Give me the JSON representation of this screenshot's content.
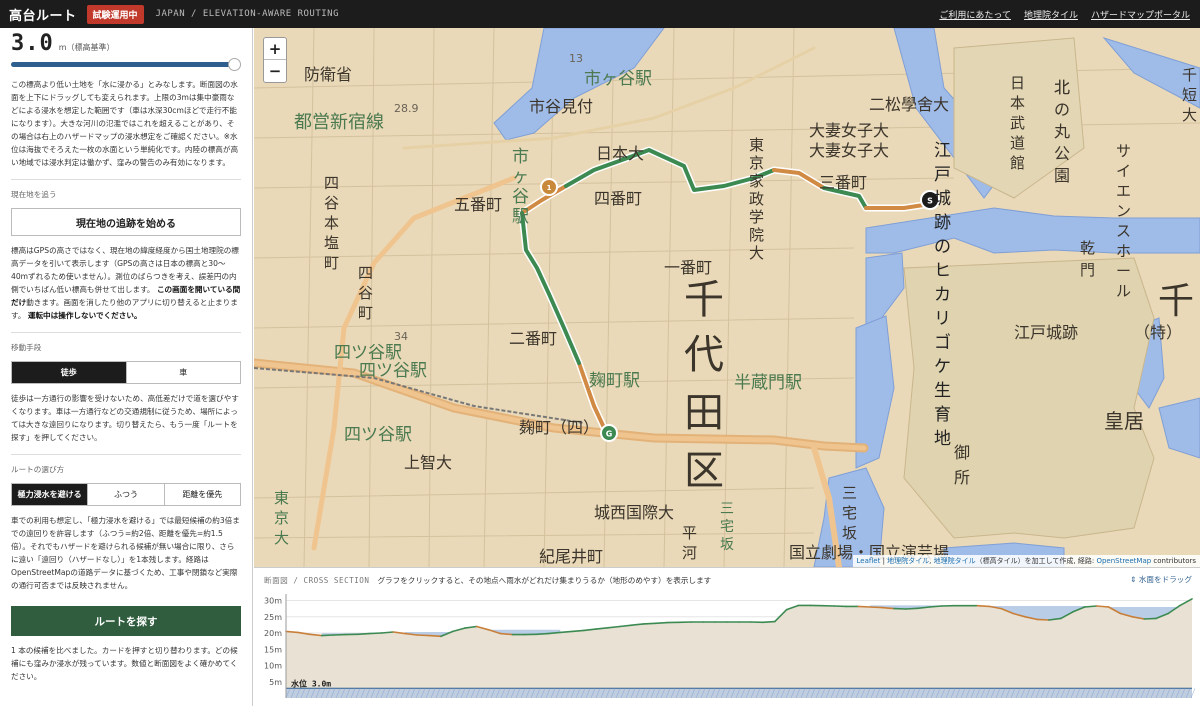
{
  "header": {
    "app_title": "高台ルート",
    "badge": "試験運用中",
    "subtitle": "JAPAN / ELEVATION-AWARE ROUTING",
    "nav": [
      "ご利用にあたって",
      "地理院タイル",
      "ハザードマップポータル"
    ]
  },
  "water_level": {
    "value": "3.0",
    "unit": "m（標高基準）",
    "fraction": 0.97,
    "description": "この標高より低い土地を「水に浸かる」とみなします。断面図の水面を上下にドラッグしても変えられます。上限の3mは集中豪雨などによる浸水を想定した範囲です（車は水深30cmほどで走行不能になります）。大きな河川の氾濫ではこれを超えることがあり、その場合は右上のハザードマップの浸水想定をご確認ください。※水位は海抜でそろえた一枚の水面という単純化です。内陸の標高が高い地域では浸水判定は働かず、窪みの警告のみ有効になります。"
  },
  "tracking": {
    "label": "現在地を追う",
    "button": "現在地の追跡を始める",
    "text_plain": "標高はGPSの高さではなく、現在地の緯度経度から国土地理院の標高データを引いて表示します（GPSの高さは日本の標高と30〜40mずれるため使いません）。測位のばらつきを考え、誤差円の内側でいちばん低い標高も併せて出します。",
    "text_bold_1": "この画面を開いている間だけ",
    "text_mid": "動きます。画面を消したり他のアプリに切り替えると止まります。",
    "text_bold_2": "運転中は操作しないでください。"
  },
  "transport": {
    "label": "移動手段",
    "options": [
      "徒歩",
      "車"
    ],
    "selected": "徒歩",
    "description": "徒歩は一方通行の影響を受けないため、高低差だけで道を選びやすくなります。車は一方通行などの交通規制に従うため、場所によっては大きな遠回りになります。切り替えたら、もう一度「ルートを探す」を押してください。"
  },
  "route_mode": {
    "label": "ルートの選び方",
    "options": [
      "極力浸水を避ける",
      "ふつう",
      "距離を優先"
    ],
    "selected": "極力浸水を避ける",
    "description": "車での利用も想定し、「極力浸水を避ける」では最短候補の約3倍までの遠回りを許容します（ふつう=約2倍、距離を優先=約1.5倍）。それでもハザードを避けられる候補が無い場合に限り、さらに遠い「遠回り（ハザードなし）」を1本残します。経路はOpenStreetMapの道路データに基づくため、工事や閉鎖など実際の通行可否までは反映されません。"
  },
  "search": {
    "button": "ルートを探す",
    "result": "1 本の候補を比べました。カードを押すと切り替わります。どの候補にも窪みか浸水が残っています。数値と断面図をよく確かめてください。"
  },
  "map": {
    "zoom_in": "+",
    "zoom_out": "−",
    "labels": {
      "district": [
        "千",
        "代",
        "田",
        "区"
      ],
      "ichigaya": "市ヶ谷駅",
      "ichigaya_v": [
        "市",
        "ヶ",
        "谷",
        "駅"
      ],
      "yotsuya": "四ツ谷駅",
      "yotsuya_big": "四ツ谷駅",
      "kojimachi": "麹町駅",
      "kojimachi_yon": "麹町（四）",
      "hanzomon": "半蔵門駅",
      "ichibancho": "一番町",
      "nibancho": "二番町",
      "sanbancho": "三番町",
      "yonbancho": "四番町",
      "gobancho": "五番町",
      "nihonbashi": "日本大",
      "toshin": "都営新宿線",
      "boeisho": "防衛省",
      "ichigayamitsuke": "市谷見付",
      "nishogakusha": "二松學舍大",
      "tsumaj1": "大妻女子大",
      "tsumaj2": "大妻女子大",
      "kaseigakuin": [
        "東",
        "京",
        "家",
        "政",
        "学",
        "院",
        "大"
      ],
      "hikari": [
        "江",
        "戸",
        "城",
        "跡",
        "の",
        "ヒ",
        "カ",
        "リ",
        "ゴ",
        "ケ",
        "生",
        "育",
        "地"
      ],
      "kitanomaru": [
        "北",
        "の",
        "丸",
        "公",
        "園"
      ],
      "budokan": [
        "日",
        "本",
        "武",
        "道",
        "館"
      ],
      "science": [
        "サ",
        "イ",
        "エ",
        "ン",
        "ス",
        "ホ",
        "ー",
        "ル"
      ],
      "edojoseki": "江戸城跡",
      "toku": "（特）",
      "kokyo": "皇居",
      "gosho": [
        "御",
        "所"
      ],
      "sophia": "上智大",
      "josai": "城西国際大",
      "kioicho": "紀尾井町",
      "hirakawa": [
        "平",
        "河"
      ],
      "miyakezaka": [
        "三",
        "宅",
        "坂"
      ],
      "miyakezaka2": [
        "三",
        "宅",
        "坂"
      ],
      "kokuritsu": "国立劇場・国立演芸場",
      "yotsuyahoncho": [
        "四",
        "谷",
        "本",
        "塩",
        "町"
      ],
      "shinmachi": [
        "四",
        "谷",
        "町"
      ],
      "kenju": [
        "乾",
        "門"
      ],
      "kita": "北",
      "tanda": [
        "千",
        "短",
        "大"
      ],
      "toukyou": [
        "東",
        "京",
        "大"
      ],
      "sen": "千",
      "h_28_9": "28.9",
      "h_13": "13",
      "h_34": "34"
    },
    "markers": {
      "start": "S",
      "goal": "G",
      "waypoint": "1"
    },
    "attribution": {
      "leaflet": "Leaflet",
      "sep": " | ",
      "tile1": "地理院タイル",
      "comma": ", ",
      "tile2": "地理院タイル",
      "mid": "（標高タイル）を加工して作成, 経路: ",
      "osm": "OpenStreetMap",
      "end": " contributors"
    }
  },
  "cross_section": {
    "title": "断面図 / CROSS SECTION",
    "hint": "グラフをクリックすると、その地点へ雨水がどれだけ集まりうるか（地形のめやす）を表示します",
    "drag": "⇕ 水面をドラッグ",
    "water_label": "水位 3.0m",
    "y_ticks": [
      "30m",
      "25m",
      "20m",
      "15m",
      "10m",
      "5m"
    ],
    "y_range": [
      0,
      32
    ],
    "water_level_m": 3.0,
    "profile_m": [
      20.5,
      20.2,
      19.6,
      19.2,
      19.4,
      19.5,
      19.6,
      19.8,
      20.0,
      20.3,
      19.8,
      19.4,
      19.2,
      19.0,
      20.5,
      21.5,
      22.0,
      21.0,
      19.8,
      19.5,
      19.5,
      19.6,
      19.8,
      20.2,
      20.5,
      20.8,
      21.2,
      21.6,
      22.0,
      22.4,
      22.8,
      23.0,
      23.2,
      23.3,
      23.4,
      23.4,
      23.4,
      23.4,
      23.4,
      23.4,
      23.3,
      23.5,
      27.2,
      28.5,
      28.5,
      28.4,
      28.3,
      28.2,
      28.2,
      28.0,
      27.8,
      27.5,
      27.4,
      27.6,
      28.0,
      28.3,
      28.4,
      28.4,
      28.4,
      28.2,
      27.5,
      26.0,
      25.0,
      24.2,
      24.0,
      24.5,
      26.5,
      28.0,
      28.3,
      28.0,
      26.0,
      25.0,
      24.3,
      24.5,
      26.0,
      28.5,
      30.5
    ]
  }
}
